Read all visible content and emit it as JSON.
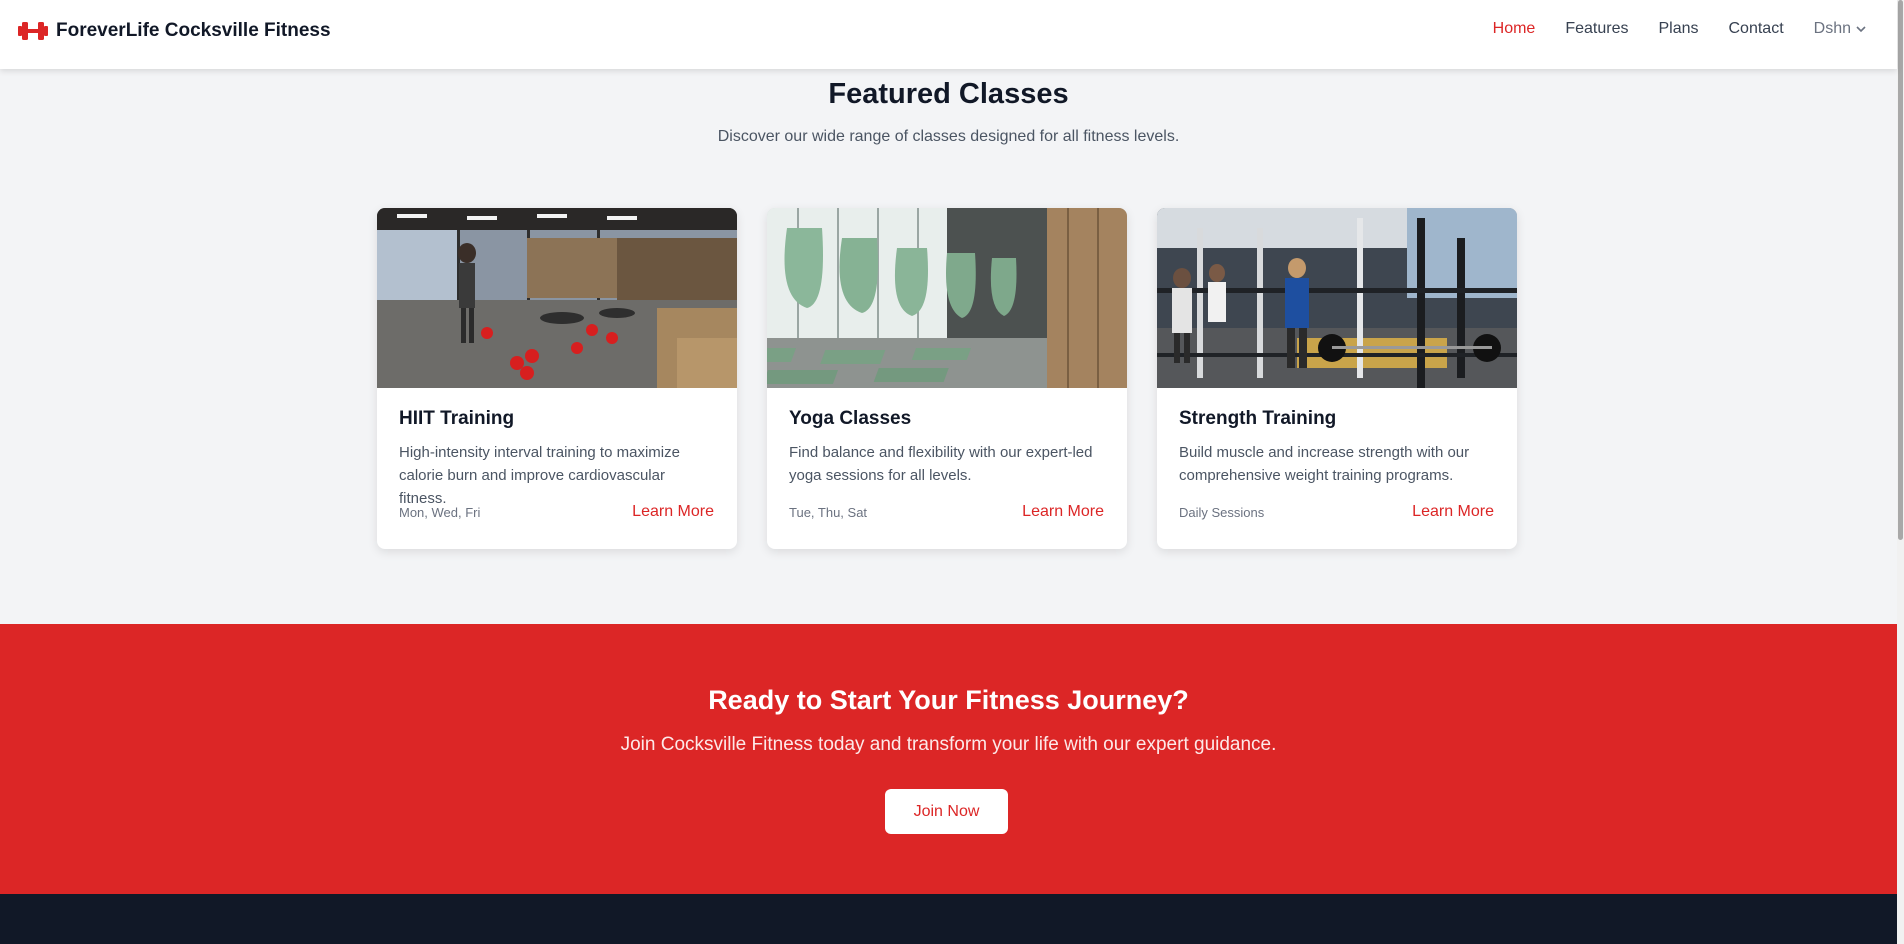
{
  "brand": {
    "name": "ForeverLife Cocksville Fitness",
    "icon": "dumbbell-icon",
    "accent": "#dc2626"
  },
  "nav": {
    "home": "Home",
    "features": "Features",
    "plans": "Plans",
    "contact": "Contact",
    "user": "Dshn"
  },
  "featured": {
    "title": "Featured Classes",
    "subtitle": "Discover our wide range of classes designed for all fitness levels.",
    "cards": [
      {
        "title": "HIIT Training",
        "desc": "High-intensity interval training to maximize calorie burn and improve cardiovascular fitness.",
        "schedule": "Mon, Wed, Fri",
        "link": "Learn More"
      },
      {
        "title": "Yoga Classes",
        "desc": "Find balance and flexibility with our expert-led yoga sessions for all levels.",
        "schedule": "Tue, Thu, Sat",
        "link": "Learn More"
      },
      {
        "title": "Strength Training",
        "desc": "Build muscle and increase strength with our comprehensive weight training programs.",
        "schedule": "Daily Sessions",
        "link": "Learn More"
      }
    ]
  },
  "cta": {
    "title": "Ready to Start Your Fitness Journey?",
    "subtitle": "Join Cocksville Fitness today and transform your life with our expert guidance.",
    "button": "Join Now"
  },
  "colors": {
    "primary": "#dc2626",
    "dark": "#111827",
    "background": "#f3f4f6"
  }
}
